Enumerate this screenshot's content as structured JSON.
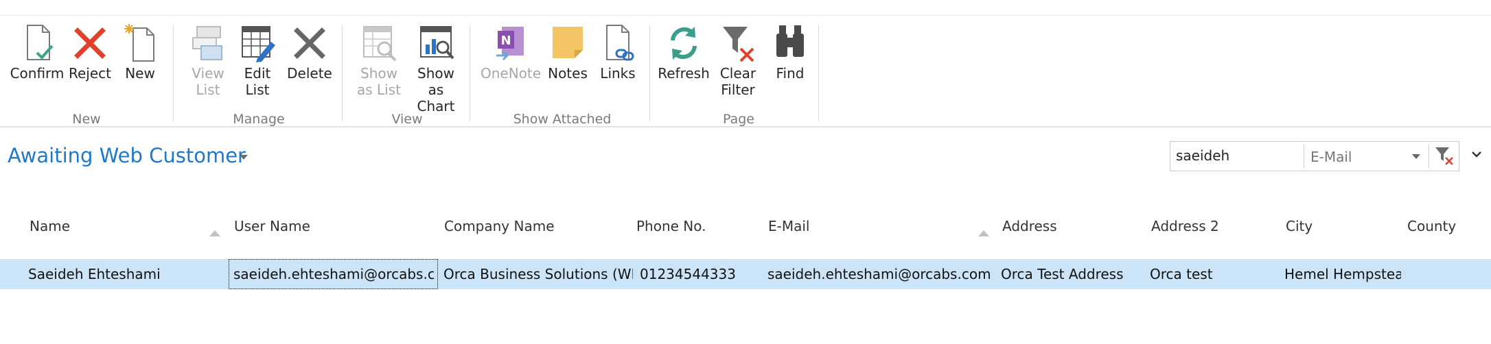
{
  "ribbon": {
    "groups": [
      {
        "label": "New",
        "buttons": [
          {
            "label": "Confirm",
            "icon": "confirm-document-icon"
          },
          {
            "label": "Reject",
            "icon": "reject-x-icon"
          },
          {
            "label": "New",
            "icon": "new-document-icon"
          }
        ]
      },
      {
        "label": "Manage",
        "buttons": [
          {
            "label": "View\nList",
            "icon": "view-list-icon"
          },
          {
            "label": "Edit\nList",
            "icon": "edit-list-icon"
          },
          {
            "label": "Delete",
            "icon": "delete-x-icon"
          }
        ]
      },
      {
        "label": "View",
        "buttons": [
          {
            "label": "Show\nas List",
            "icon": "show-as-list-icon"
          },
          {
            "label": "Show as\nChart",
            "icon": "show-as-chart-icon"
          }
        ]
      },
      {
        "label": "Show Attached",
        "buttons": [
          {
            "label": "OneNote",
            "icon": "onenote-icon"
          },
          {
            "label": "Notes",
            "icon": "notes-icon"
          },
          {
            "label": "Links",
            "icon": "links-icon"
          }
        ]
      },
      {
        "label": "Page",
        "buttons": [
          {
            "label": "Refresh",
            "icon": "refresh-icon"
          },
          {
            "label": "Clear\nFilter",
            "icon": "clear-filter-icon"
          },
          {
            "label": "Find",
            "icon": "binoculars-icon"
          }
        ]
      }
    ]
  },
  "page": {
    "title": "Awaiting Web Customer"
  },
  "search": {
    "value": "saeideh",
    "field": "E-Mail"
  },
  "table": {
    "columns": [
      "Name",
      "User Name",
      "Company Name",
      "Phone No.",
      "E-Mail",
      "Address",
      "Address 2",
      "City",
      "County"
    ],
    "rows": [
      {
        "name": "Saeideh Ehteshami",
        "user_name": "saeideh.ehteshami@orcabs.com",
        "company_name": "Orca Business Solutions (WEB TE…",
        "phone": "01234544333",
        "email": "saeideh.ehteshami@orcabs.com",
        "address": "Orca Test Address",
        "address2": "Orca test",
        "city": "Hemel Hempstead",
        "county": ""
      }
    ]
  },
  "colors": {
    "accent": "#1d79cd",
    "selected_row": "#cce4f7",
    "reject": "#e0412a",
    "confirm_check": "#3aa58a"
  }
}
